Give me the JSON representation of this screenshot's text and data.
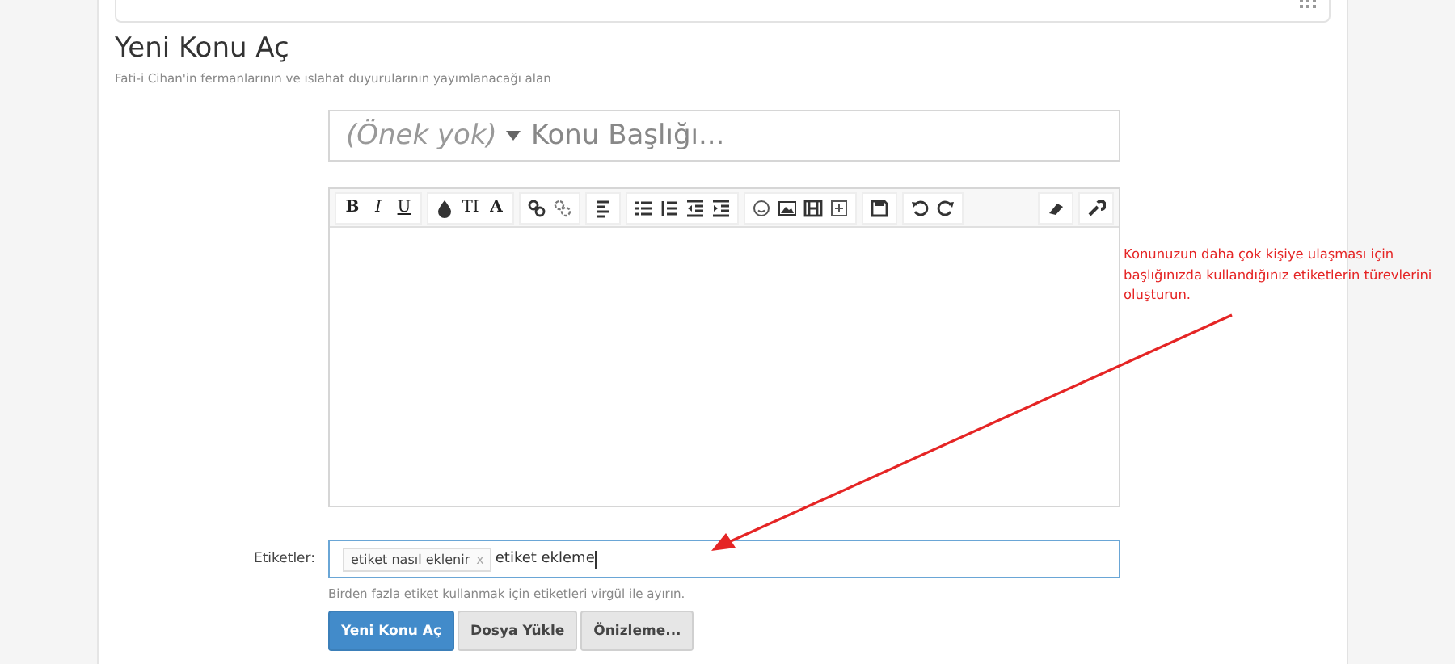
{
  "page": {
    "title": "Yeni Konu Aç",
    "description": "Fati-i Cihan'in fermanlarının ve ıslahat duyurularının yayımlanacağı alan"
  },
  "title_field": {
    "prefix": "(Önek yok)",
    "placeholder": "Konu Başlığı..."
  },
  "editor_toolbar": [
    {
      "kind": "bold",
      "label": "B"
    },
    {
      "kind": "italic",
      "label": "I"
    },
    {
      "kind": "underline",
      "label": "U"
    },
    {
      "kind": "size",
      "label": "TI"
    },
    {
      "kind": "font",
      "label": "A"
    }
  ],
  "tags": {
    "label": "Etiketler:",
    "chips": [
      "etiket nasıl eklenir"
    ],
    "remove_glyph": "x",
    "value": "etiket ekleme",
    "hint": "Birden fazla etiket kullanmak için etiketleri virgül ile ayırın."
  },
  "buttons": [
    {
      "label": "Yeni Konu Aç",
      "kind": "primary"
    },
    {
      "label": "Dosya Yükle",
      "kind": "default"
    },
    {
      "label": "Önizleme...",
      "kind": "default"
    }
  ],
  "annotation": {
    "text": "Konunuzun daha çok kişiye ulaşması için başlığınızda kullandığınız etiketlerin türevlerini oluşturun."
  }
}
